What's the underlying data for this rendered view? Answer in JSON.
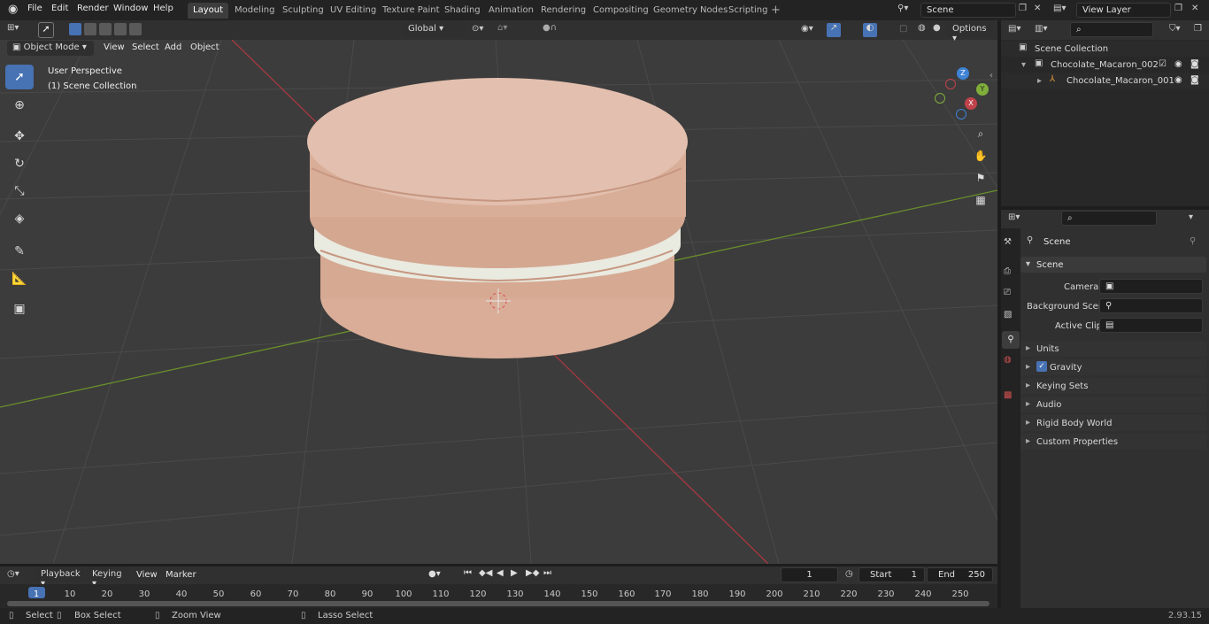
{
  "menus": [
    "File",
    "Edit",
    "Render",
    "Window",
    "Help"
  ],
  "workspaces": [
    "Layout",
    "Modeling",
    "Sculpting",
    "UV Editing",
    "Texture Paint",
    "Shading",
    "Animation",
    "Rendering",
    "Compositing",
    "Geometry Nodes",
    "Scripting"
  ],
  "scene_name": "Scene",
  "view_layer": "View Layer",
  "viewport": {
    "mode": "Object Mode",
    "menus": [
      "View",
      "Select",
      "Add",
      "Object"
    ],
    "transform": "Global",
    "options": "Options",
    "overlay_title": "User Perspective",
    "overlay_sub": "(1) Scene Collection"
  },
  "gizmo": {
    "z": "Z",
    "y": "Y",
    "x": "X"
  },
  "outliner": {
    "root": "Scene Collection",
    "items": [
      "Chocolate_Macaron_002",
      "Chocolate_Macaron_001"
    ]
  },
  "properties": {
    "title": "Scene",
    "section": "Scene",
    "camera_label": "Camera",
    "bg_scene_label": "Background Scene",
    "active_clip_label": "Active Clip",
    "panels": [
      "Units",
      "Gravity",
      "Keying Sets",
      "Audio",
      "Rigid Body World",
      "Custom Properties"
    ]
  },
  "timeline": {
    "menus": [
      "Playback",
      "Keying",
      "View",
      "Marker"
    ],
    "current_frame": "1",
    "start_label": "Start",
    "start": "1",
    "end_label": "End",
    "end": "250",
    "ticks": [
      "1",
      "10",
      "20",
      "30",
      "40",
      "50",
      "60",
      "70",
      "80",
      "90",
      "100",
      "110",
      "120",
      "130",
      "140",
      "150",
      "160",
      "170",
      "180",
      "190",
      "200",
      "210",
      "220",
      "230",
      "240",
      "250"
    ]
  },
  "status": {
    "select": "Select",
    "box_select": "Box Select",
    "zoom_view": "Zoom View",
    "lasso_select": "Lasso Select",
    "version": "2.93.15"
  },
  "colors": {
    "accent": "#4772b3",
    "x_axis": "#c0424a",
    "y_axis": "#7fae3a",
    "z_axis": "#3f83d5"
  }
}
